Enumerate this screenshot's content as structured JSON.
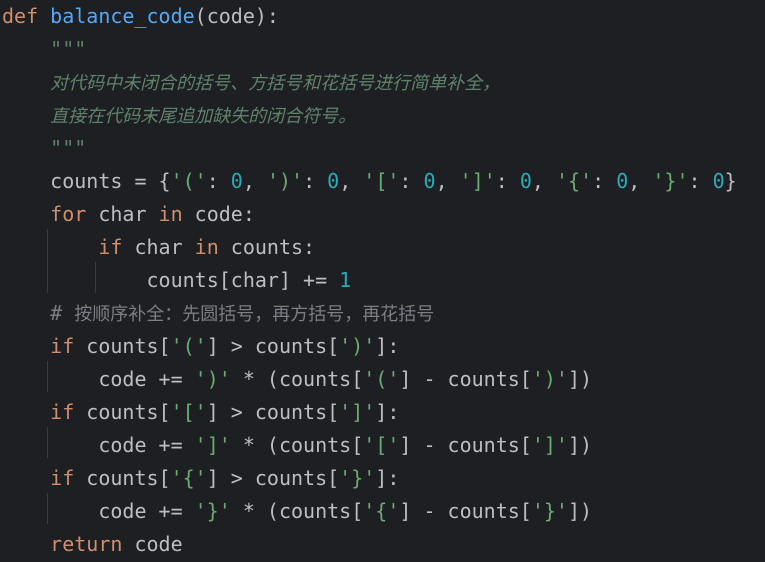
{
  "code_lines": [
    [
      [
        "kw",
        "def"
      ],
      [
        "txt",
        " "
      ],
      [
        "fn",
        "balance_code"
      ],
      [
        "txt",
        "(code):"
      ]
    ],
    [
      [
        "txt",
        "    "
      ],
      [
        "doc",
        "\"\"\""
      ]
    ],
    [
      [
        "txt",
        "    "
      ],
      [
        "doc-cn",
        "对代码中未闭合的括号、方括号和花括号进行简单补全，"
      ]
    ],
    [
      [
        "txt",
        "    "
      ],
      [
        "doc-cn",
        "直接在代码末尾追加缺失的闭合符号。"
      ]
    ],
    [
      [
        "txt",
        "    "
      ],
      [
        "doc",
        "\"\"\""
      ]
    ],
    [
      [
        "txt",
        "    counts = {"
      ],
      [
        "str",
        "'('"
      ],
      [
        "txt",
        ": "
      ],
      [
        "num",
        "0"
      ],
      [
        "txt",
        ", "
      ],
      [
        "str",
        "')'"
      ],
      [
        "txt",
        ": "
      ],
      [
        "num",
        "0"
      ],
      [
        "txt",
        ", "
      ],
      [
        "str",
        "'['"
      ],
      [
        "txt",
        ": "
      ],
      [
        "num",
        "0"
      ],
      [
        "txt",
        ", "
      ],
      [
        "str",
        "']'"
      ],
      [
        "txt",
        ": "
      ],
      [
        "num",
        "0"
      ],
      [
        "txt",
        ", "
      ],
      [
        "str",
        "'{'"
      ],
      [
        "txt",
        ": "
      ],
      [
        "num",
        "0"
      ],
      [
        "txt",
        ", "
      ],
      [
        "str",
        "'}'"
      ],
      [
        "txt",
        ": "
      ],
      [
        "num",
        "0"
      ],
      [
        "txt",
        "}"
      ]
    ],
    [
      [
        "txt",
        "    "
      ],
      [
        "kw",
        "for"
      ],
      [
        "txt",
        " char "
      ],
      [
        "kw",
        "in"
      ],
      [
        "txt",
        " code:"
      ]
    ],
    [
      [
        "txt",
        "        "
      ],
      [
        "kw",
        "if"
      ],
      [
        "txt",
        " char "
      ],
      [
        "kw",
        "in"
      ],
      [
        "txt",
        " counts:"
      ]
    ],
    [
      [
        "txt",
        "            counts[char] += "
      ],
      [
        "num",
        "1"
      ]
    ],
    [
      [
        "txt",
        "    "
      ],
      [
        "cmt",
        "# "
      ],
      [
        "cmt-cn",
        "按顺序补全：先圆括号，再方括号，再花括号"
      ]
    ],
    [
      [
        "txt",
        "    "
      ],
      [
        "kw",
        "if"
      ],
      [
        "txt",
        " counts["
      ],
      [
        "str",
        "'('"
      ],
      [
        "txt",
        "] > counts["
      ],
      [
        "str",
        "')'"
      ],
      [
        "txt",
        "]:"
      ]
    ],
    [
      [
        "txt",
        "        code += "
      ],
      [
        "str",
        "')'"
      ],
      [
        "txt",
        " * (counts["
      ],
      [
        "str",
        "'('"
      ],
      [
        "txt",
        "] - counts["
      ],
      [
        "str",
        "')'"
      ],
      [
        "txt",
        "])"
      ]
    ],
    [
      [
        "txt",
        "    "
      ],
      [
        "kw",
        "if"
      ],
      [
        "txt",
        " counts["
      ],
      [
        "str",
        "'['"
      ],
      [
        "txt",
        "] > counts["
      ],
      [
        "str",
        "']'"
      ],
      [
        "txt",
        "]:"
      ]
    ],
    [
      [
        "txt",
        "        code += "
      ],
      [
        "str",
        "']'"
      ],
      [
        "txt",
        " * (counts["
      ],
      [
        "str",
        "'['"
      ],
      [
        "txt",
        "] - counts["
      ],
      [
        "str",
        "']'"
      ],
      [
        "txt",
        "])"
      ]
    ],
    [
      [
        "txt",
        "    "
      ],
      [
        "kw",
        "if"
      ],
      [
        "txt",
        " counts["
      ],
      [
        "str",
        "'{'"
      ],
      [
        "txt",
        "] > counts["
      ],
      [
        "str",
        "'}'"
      ],
      [
        "txt",
        "]:"
      ]
    ],
    [
      [
        "txt",
        "        code += "
      ],
      [
        "str",
        "'}'"
      ],
      [
        "txt",
        " * (counts["
      ],
      [
        "str",
        "'{'"
      ],
      [
        "txt",
        "] - counts["
      ],
      [
        "str",
        "'}'"
      ],
      [
        "txt",
        "])"
      ]
    ],
    [
      [
        "txt",
        "    "
      ],
      [
        "kw",
        "return"
      ],
      [
        "txt",
        " code"
      ]
    ]
  ]
}
